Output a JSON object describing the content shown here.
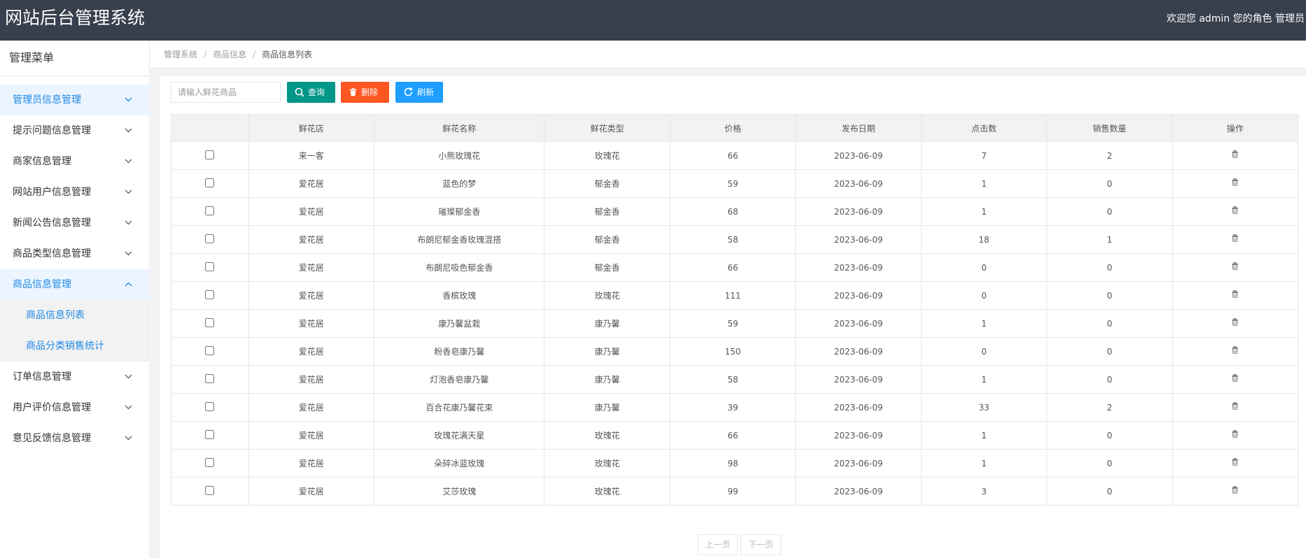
{
  "header": {
    "title": "网站后台管理系统",
    "welcome": "欢迎您 admin 您的角色 管理员"
  },
  "sidebar": {
    "heading": "管理菜单",
    "items": [
      {
        "label": "管理员信息管理"
      },
      {
        "label": "提示问题信息管理"
      },
      {
        "label": "商家信息管理"
      },
      {
        "label": "网站用户信息管理"
      },
      {
        "label": "新闻公告信息管理"
      },
      {
        "label": "商品类型信息管理"
      },
      {
        "label": "商品信息管理"
      },
      {
        "label": "订单信息管理"
      },
      {
        "label": "用户评价信息管理"
      },
      {
        "label": "意见反馈信息管理"
      }
    ],
    "submenu": [
      {
        "label": "商品信息列表"
      },
      {
        "label": "商品分类销售统计"
      }
    ]
  },
  "breadcrumb": {
    "items": [
      "管理系统",
      "商品信息",
      "商品信息列表"
    ]
  },
  "toolbar": {
    "search_placeholder": "请输入鲜花商品",
    "query_label": "查询",
    "delete_label": "删除",
    "refresh_label": "刷新"
  },
  "table": {
    "headers": [
      "",
      "鲜花店",
      "鲜花名称",
      "鲜花类型",
      "价格",
      "发布日期",
      "点击数",
      "销售数量",
      "操作"
    ],
    "rows": [
      [
        "来一客",
        "小熊玫瑰花",
        "玫瑰花",
        "66",
        "2023-06-09",
        "7",
        "2"
      ],
      [
        "爱花居",
        "蓝色的梦",
        "郁金香",
        "59",
        "2023-06-09",
        "1",
        "0"
      ],
      [
        "爱花居",
        "璀璨郁金香",
        "郁金香",
        "68",
        "2023-06-09",
        "1",
        "0"
      ],
      [
        "爱花居",
        "布朗尼郁金香玫瑰混搭",
        "郁金香",
        "58",
        "2023-06-09",
        "18",
        "1"
      ],
      [
        "爱花居",
        "布朗尼吸色郁金香",
        "郁金香",
        "66",
        "2023-06-09",
        "0",
        "0"
      ],
      [
        "爱花居",
        "香槟玫瑰",
        "玫瑰花",
        "111",
        "2023-06-09",
        "0",
        "0"
      ],
      [
        "爱花居",
        "康乃馨盆栽",
        "康乃馨",
        "59",
        "2023-06-09",
        "1",
        "0"
      ],
      [
        "爱花居",
        "粉香皂康乃馨",
        "康乃馨",
        "150",
        "2023-06-09",
        "0",
        "0"
      ],
      [
        "爱花居",
        "灯泡香皂康乃馨",
        "康乃馨",
        "58",
        "2023-06-09",
        "1",
        "0"
      ],
      [
        "爱花居",
        "百合花康乃馨花束",
        "康乃馨",
        "39",
        "2023-06-09",
        "33",
        "2"
      ],
      [
        "爱花居",
        "玫瑰花满天星",
        "玫瑰花",
        "66",
        "2023-06-09",
        "1",
        "0"
      ],
      [
        "爱花居",
        "朵碎冰蓝玫瑰",
        "玫瑰花",
        "98",
        "2023-06-09",
        "1",
        "0"
      ],
      [
        "爱花居",
        "艾莎玫瑰",
        "玫瑰花",
        "99",
        "2023-06-09",
        "3",
        "0"
      ]
    ]
  },
  "pager": {
    "prev": "上一页",
    "next": "下一页"
  },
  "colors": {
    "header_bg": "#383f4d",
    "accent": "#1e88e5",
    "query": "#009688",
    "delete": "#ff5722",
    "refresh": "#1e9fff"
  }
}
